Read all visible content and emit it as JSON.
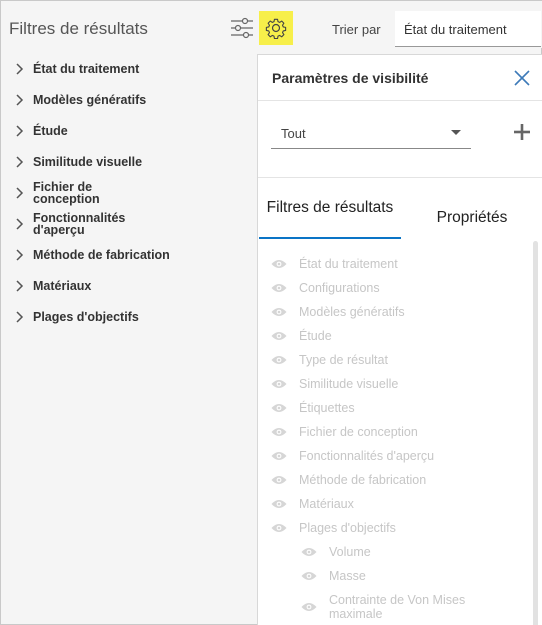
{
  "left_panel": {
    "title": "Filtres de résultats",
    "items": [
      {
        "label": "État du traitement"
      },
      {
        "label": "Modèles génératifs"
      },
      {
        "label": "Étude"
      },
      {
        "label": "Similitude visuelle"
      },
      {
        "label": "Fichier de conception"
      },
      {
        "label": "Fonctionnalités d'aperçu"
      },
      {
        "label": "Méthode de fabrication"
      },
      {
        "label": "Matériaux"
      },
      {
        "label": "Plages d'objectifs"
      }
    ]
  },
  "sort": {
    "label": "Trier par",
    "value": "État du traitement"
  },
  "popover": {
    "title": "Paramètres de visibilité",
    "scope_value": "Tout",
    "tabs": [
      {
        "label": "Filtres de résultats",
        "active": true
      },
      {
        "label": "Propriétés",
        "active": false
      }
    ],
    "visibility_items": [
      {
        "label": "État du traitement"
      },
      {
        "label": "Configurations"
      },
      {
        "label": "Modèles génératifs"
      },
      {
        "label": "Étude"
      },
      {
        "label": "Type de résultat"
      },
      {
        "label": "Similitude visuelle"
      },
      {
        "label": "Étiquettes"
      },
      {
        "label": "Fichier de conception"
      },
      {
        "label": "Fonctionnalités d'aperçu"
      },
      {
        "label": "Méthode de fabrication"
      },
      {
        "label": "Matériaux"
      },
      {
        "label": "Plages d'objectifs"
      }
    ],
    "visibility_subitems": [
      {
        "label": "Volume"
      },
      {
        "label": "Masse"
      },
      {
        "label": "Contrainte de Von Mises maximale"
      }
    ]
  },
  "colors": {
    "gear_highlight": "#f7ef4a",
    "tab_underline": "#0a74c6",
    "disabled_text": "#c6c6c6"
  },
  "icons": {
    "sliders": "sliders-icon",
    "gear": "gear-icon",
    "chevron": "chevron-right-icon",
    "close": "close-icon",
    "add": "plus-icon",
    "eye": "eye-icon"
  }
}
